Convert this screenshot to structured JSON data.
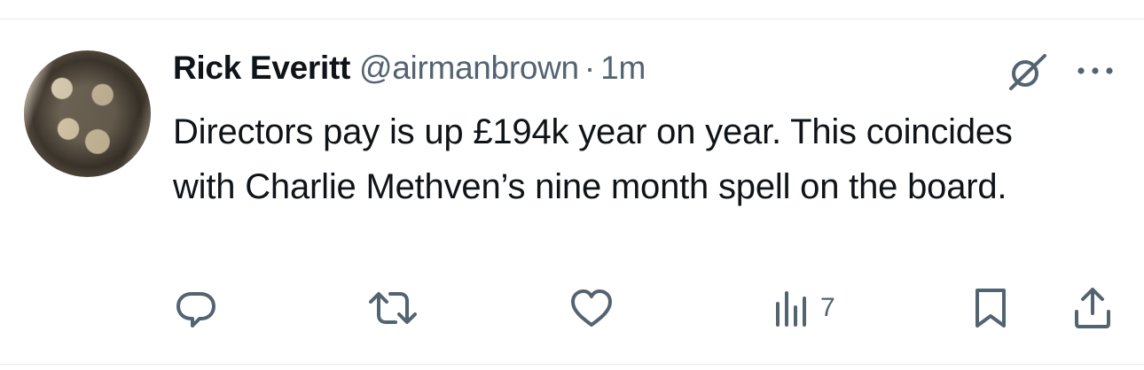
{
  "tweet": {
    "display_name": "Rick Everitt",
    "handle": "@airmanbrown",
    "separator": "·",
    "timestamp": "1m",
    "text": "Directors pay is up £194k year on year. This coincides with Charlie Methven’s nine month spell on the board."
  },
  "actions": {
    "views_count": "7"
  },
  "icons": {
    "reply": "reply-icon",
    "retweet": "retweet-icon",
    "like": "heart-icon",
    "views": "views-icon",
    "bookmark": "bookmark-icon",
    "share": "share-icon",
    "grok": "grok-icon",
    "more": "more-icon"
  },
  "colors": {
    "text": "#0f1419",
    "secondary": "#536471",
    "divider": "#e6e9eb"
  }
}
